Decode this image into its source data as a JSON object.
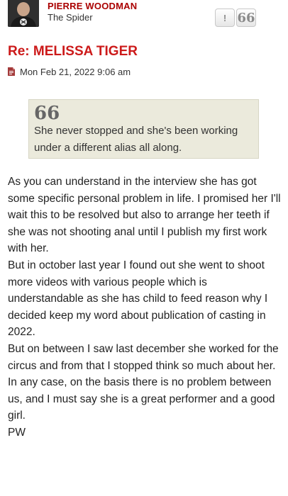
{
  "author": {
    "name": "PIERRE WOODMAN",
    "rank": "The Spider"
  },
  "actions": {
    "report_label": "!",
    "quote_label": "66"
  },
  "post": {
    "title": "Re: MELISSA TIGER",
    "date": "Mon Feb 21, 2022 9:06 am",
    "quote": {
      "mark": "66",
      "text": "She never stopped and she's been working under a different alias all along."
    },
    "paragraphs": [
      "As you can understand in the interview she has got some specific personal problem in life. I promised her I'll wait this to be resolved but also to arrange her teeth if she was not shooting anal until I publish my first work with her.",
      "But in october last year I found out she went to shoot more videos with various people which is understandable as she has child to feed reason why I decided keep my word about publication of casting in 2022.",
      "But on between I saw last december she worked for the circus and from that I stopped think so much about her.",
      "In any case, on the basis there is no problem between us, and I must say she is a great performer and a good girl."
    ],
    "signature": "PW"
  },
  "colors": {
    "author_name": "#aa0000",
    "title": "#cc1a1a",
    "quote_background": "#ebeadc"
  },
  "icons": {
    "post": "file-icon",
    "report": "exclamation-icon",
    "quote": "quote-icon"
  }
}
